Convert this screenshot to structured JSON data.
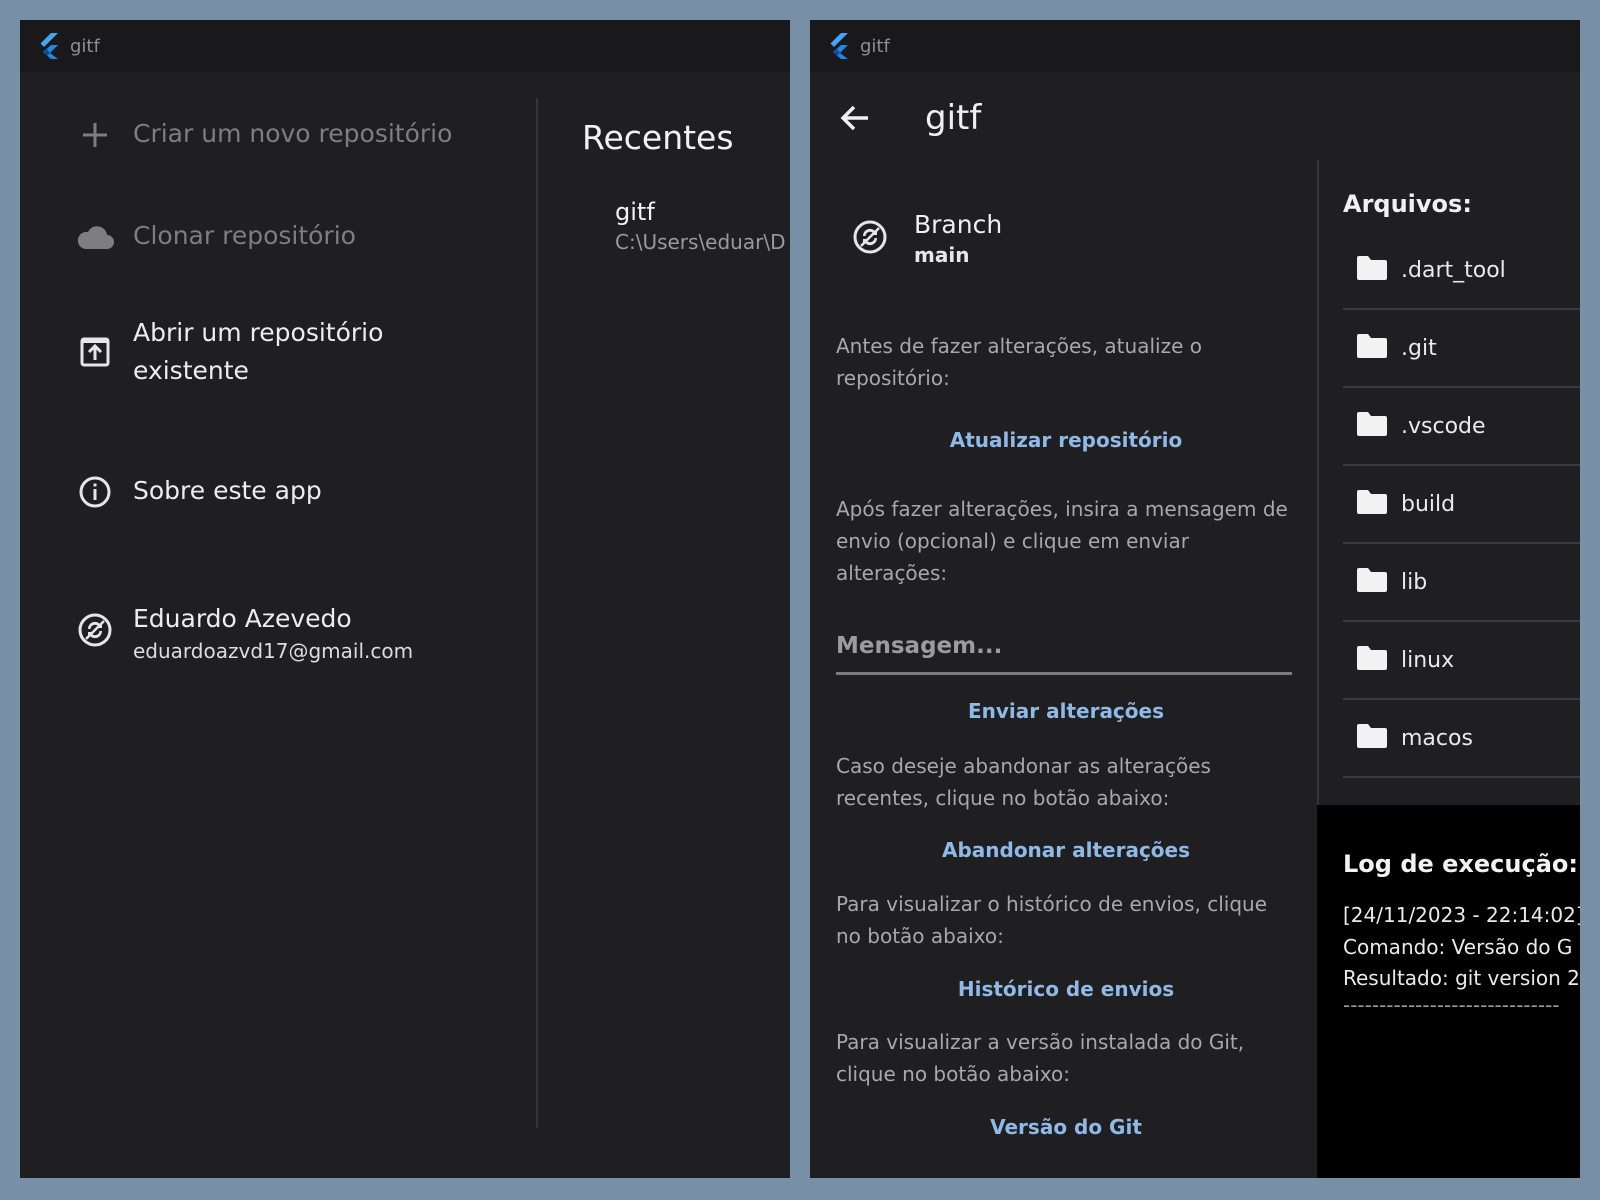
{
  "left_window": {
    "title": "gitf",
    "menu": {
      "create": "Criar um novo repositório",
      "clone": "Clonar repositório",
      "open": "Abrir um repositório existente",
      "about": "Sobre este app",
      "user_name": "Eduardo Azevedo",
      "user_email": "eduardoazvd17@gmail.com"
    },
    "recents": {
      "title": "Recentes",
      "items": [
        {
          "name": "gitf",
          "path": "C:\\Users\\eduar\\D"
        }
      ]
    }
  },
  "right_window": {
    "title": "gitf",
    "app_title": "gitf",
    "branch": {
      "label": "Branch",
      "value": "main"
    },
    "update_text": "Antes de fazer alterações, atualize o repositório:",
    "update_button": "Atualizar repositório",
    "commit_text": "Após fazer alterações, insira a mensagem de envio (opcional) e clique em enviar alterações:",
    "message_placeholder": "Mensagem...",
    "send_button": "Enviar alterações",
    "discard_text": "Caso deseje abandonar as alterações recentes, clique no botão abaixo:",
    "discard_button": "Abandonar alterações",
    "history_text": "Para visualizar o histórico de envios, clique no botão abaixo:",
    "history_button": "Histórico de envios",
    "version_text": "Para visualizar a versão instalada do Git, clique no botão abaixo:",
    "version_button": "Versão do Git",
    "files": {
      "header": "Arquivos:",
      "items": [
        ".dart_tool",
        ".git",
        ".vscode",
        "build",
        "lib",
        "linux",
        "macos"
      ]
    },
    "log": {
      "header": "Log de execução:",
      "lines": [
        "[24/11/2023 - 22:14:02]",
        "Comando: Versão do G",
        "Resultado: git version 2",
        "------------------------------"
      ]
    }
  },
  "colors": {
    "background": "#7890a7",
    "window": "#1f1f22",
    "accent_link": "#8fb9e6",
    "flutter_blue": "#42a5f5"
  }
}
